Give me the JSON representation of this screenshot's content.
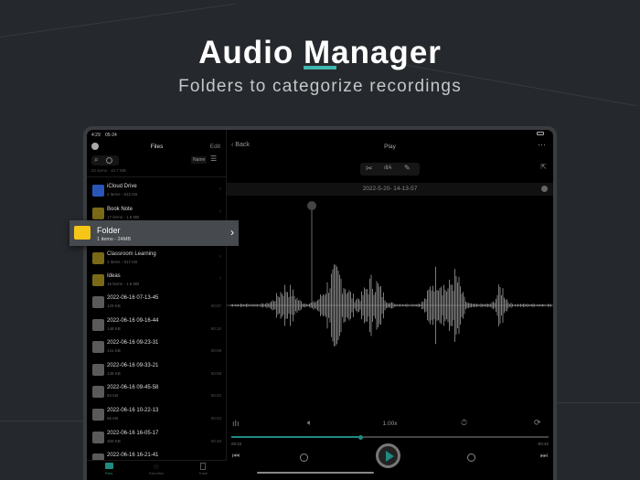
{
  "header": {
    "title_pre": "Audio ",
    "title_m": "M",
    "title_post": "anager",
    "subtitle": "Folders to categorize recordings"
  },
  "status": {
    "time": "4:29",
    "date": "05-24"
  },
  "files": {
    "title": "Files",
    "edit": "Edit",
    "sort": "Name",
    "summary": "22 items - 10.7 MB",
    "folders": [
      {
        "name": "iCloud Drive",
        "info": "2 items - 812 KB",
        "kind": "icloud"
      },
      {
        "name": "Book Note",
        "info": "17 items - 1.9 MB",
        "kind": "folder"
      }
    ],
    "highlight": {
      "name": "Folder",
      "info": "1 items - 24MB"
    },
    "folders2": [
      {
        "name": "Classroom Learning",
        "info": "3 items - 917 KB"
      },
      {
        "name": "Ideas",
        "info": "15 items - 1.6 MB"
      }
    ],
    "recordings": [
      {
        "name": "2022-06-16 07-13-45",
        "size": "129 KB",
        "dur": "00:07"
      },
      {
        "name": "2022-06-16 09-16-44",
        "size": "148 KB",
        "dur": "00:10"
      },
      {
        "name": "2022-06-16 09-23-31",
        "size": "141 KB",
        "dur": "00:09"
      },
      {
        "name": "2022-06-16 09-33-21",
        "size": "138 KB",
        "dur": "00:08"
      },
      {
        "name": "2022-06-16 09-45-58",
        "size": "84 KB",
        "dur": "00:02"
      },
      {
        "name": "2022-06-16 10-22-13",
        "size": "96 KB",
        "dur": "00:03"
      },
      {
        "name": "2022-06-16 16-05-17",
        "size": "460 KB",
        "dur": "00:49"
      },
      {
        "name": "2022-06-16 16-21-41",
        "size": "",
        "dur": ""
      }
    ],
    "tabs": [
      "Files",
      "Favorites",
      "Trash"
    ]
  },
  "player": {
    "back": "Back",
    "title": "Play",
    "recording": "2022-5-20- 14-13-57",
    "speed": "1.00x",
    "elapsed": "00:22",
    "remaining": "-00:32",
    "progress": 0.41,
    "accent": "#1f8a80"
  }
}
